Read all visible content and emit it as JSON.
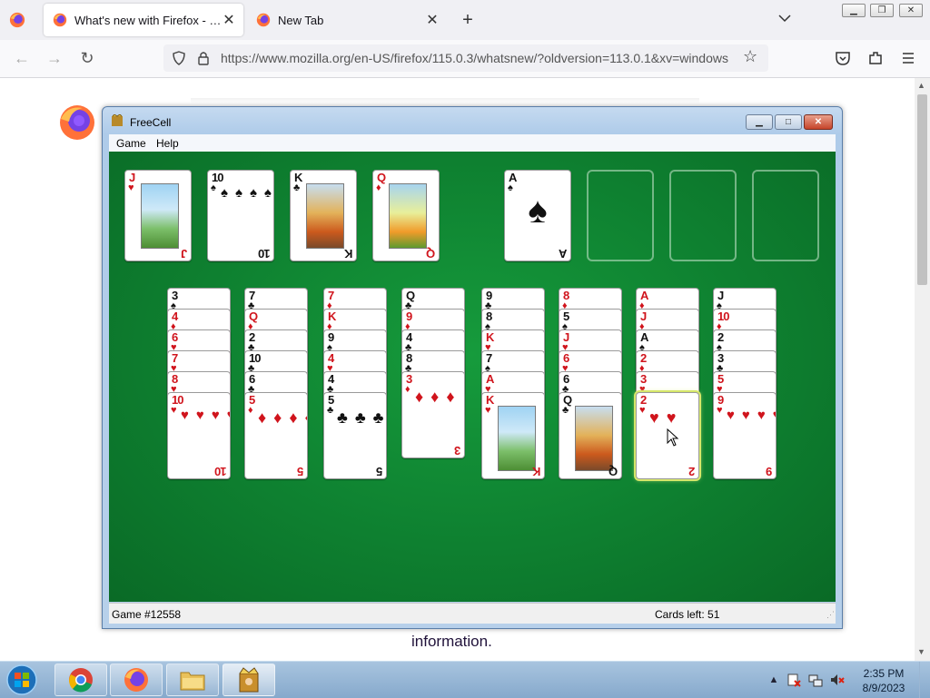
{
  "browser": {
    "tabs": [
      {
        "label": "What's new with Firefox - More",
        "active": true
      },
      {
        "label": "New Tab",
        "active": false
      }
    ],
    "url": "https://www.mozilla.org/en-US/firefox/115.0.3/whatsnew/?oldversion=113.0.1&xv=windows",
    "window_controls": [
      "minimize",
      "restore",
      "close"
    ],
    "icons": [
      "firefox-menu-icon",
      "back-icon",
      "forward-icon",
      "reload-icon",
      "shield-icon",
      "lock-icon",
      "bookmark-star-icon",
      "pocket-icon",
      "extensions-icon",
      "app-menu-icon",
      "list-all-tabs-icon"
    ]
  },
  "page": {
    "text": "information."
  },
  "freecell": {
    "title": "FreeCell",
    "menu": [
      "Game",
      "Help"
    ],
    "status": {
      "game": "Game #12558",
      "cards_left": "Cards left: 51"
    },
    "free_cells": [
      {
        "rank": "J",
        "suit": "♥",
        "color": "red",
        "face": true
      },
      {
        "rank": "10",
        "suit": "♠",
        "color": "black",
        "face": false
      },
      {
        "rank": "K",
        "suit": "♣",
        "color": "black",
        "face": true
      },
      {
        "rank": "Q",
        "suit": "♦",
        "color": "red",
        "face": true
      }
    ],
    "foundations": [
      {
        "rank": "A",
        "suit": "♠",
        "color": "black"
      },
      null,
      null,
      null
    ],
    "columns": [
      [
        [
          "3",
          "♠"
        ],
        [
          "4",
          "♦"
        ],
        [
          "6",
          "♥"
        ],
        [
          "7",
          "♥"
        ],
        [
          "8",
          "♥"
        ],
        [
          "10",
          "♥"
        ]
      ],
      [
        [
          "7",
          "♣"
        ],
        [
          "Q",
          "♦"
        ],
        [
          "2",
          "♣"
        ],
        [
          "10",
          "♣"
        ],
        [
          "6",
          "♣"
        ],
        [
          "5",
          "♦"
        ]
      ],
      [
        [
          "7",
          "♦"
        ],
        [
          "K",
          "♦"
        ],
        [
          "9",
          "♠"
        ],
        [
          "4",
          "♥"
        ],
        [
          "4",
          "♣"
        ],
        [
          "5",
          "♣"
        ]
      ],
      [
        [
          "Q",
          "♣"
        ],
        [
          "9",
          "♦"
        ],
        [
          "4",
          "♣"
        ],
        [
          "8",
          "♣"
        ],
        [
          "3",
          "♦"
        ]
      ],
      [
        [
          "9",
          "♣"
        ],
        [
          "8",
          "♠"
        ],
        [
          "K",
          "♥"
        ],
        [
          "7",
          "♠"
        ],
        [
          "A",
          "♥"
        ],
        [
          "K",
          "♥"
        ]
      ],
      [
        [
          "8",
          "♦"
        ],
        [
          "5",
          "♠"
        ],
        [
          "J",
          "♥"
        ],
        [
          "6",
          "♥"
        ],
        [
          "6",
          "♣"
        ],
        [
          "Q",
          "♣"
        ]
      ],
      [
        [
          "A",
          "♦"
        ],
        [
          "J",
          "♦"
        ],
        [
          "A",
          "♠"
        ],
        [
          "2",
          "♦"
        ],
        [
          "3",
          "♥"
        ],
        [
          "2",
          "♥"
        ]
      ],
      [
        [
          "J",
          "♠"
        ],
        [
          "10",
          "♦"
        ],
        [
          "2",
          "♠"
        ],
        [
          "3",
          "♣"
        ],
        [
          "5",
          "♥"
        ],
        [
          "9",
          "♥"
        ]
      ]
    ],
    "selected_column": 6
  },
  "taskbar": {
    "pinned": [
      "chrome-icon",
      "firefox-icon",
      "explorer-icon",
      "freecell-icon"
    ],
    "clock_time": "2:35 PM",
    "clock_date": "8/9/2023"
  }
}
